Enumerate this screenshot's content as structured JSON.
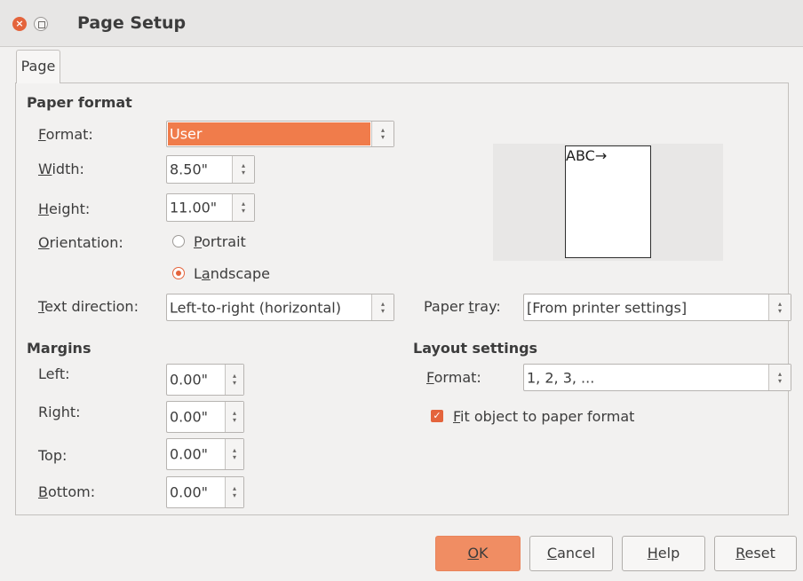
{
  "titlebar": {
    "title": "Page Setup",
    "close_glyph": "×",
    "close_icon": "close-icon",
    "maximize_icon": "maximize-icon"
  },
  "tabs": [
    {
      "label": "Page",
      "active": true
    }
  ],
  "paper_format": {
    "heading": "Paper format",
    "format": {
      "label_ul": "F",
      "label_rest": "ormat:",
      "value": "User"
    },
    "width": {
      "label_ul": "W",
      "label_rest": "idth:",
      "value": "8.50\""
    },
    "height": {
      "label_ul": "H",
      "label_rest": "eight:",
      "value": "11.00\""
    },
    "orientation": {
      "label_ul": "O",
      "label_rest": "rientation:",
      "portrait": {
        "label_ul": "P",
        "label_rest": "ortrait",
        "checked": false
      },
      "landscape": {
        "label_pre": "L",
        "label_ul": "a",
        "label_rest": "ndscape",
        "checked": true
      }
    },
    "text_direction": {
      "label_ul": "T",
      "label_rest": "ext direction:",
      "value": "Left-to-right (horizontal)"
    },
    "paper_tray": {
      "label_pre": "Paper ",
      "label_ul": "t",
      "label_rest": "ray:",
      "value": "[From printer settings]"
    },
    "preview_text": "ABC→"
  },
  "margins": {
    "heading": "Margins",
    "left": {
      "label": "Left:",
      "value": "0.00\""
    },
    "right": {
      "label": "Right:",
      "value": "0.00\""
    },
    "top": {
      "label": "Top:",
      "value": "0.00\""
    },
    "bottom": {
      "label_ul": "B",
      "label_rest": "ottom:",
      "value": "0.00\""
    }
  },
  "layout": {
    "heading": "Layout settings",
    "format": {
      "label_ul": "F",
      "label_rest": "ormat:",
      "value": "1, 2, 3, ..."
    },
    "fit": {
      "label_ul": "F",
      "label_rest": "it object to paper format",
      "checked": true,
      "check_glyph": "✓"
    }
  },
  "buttons": {
    "ok": {
      "ul": "O",
      "rest": "K"
    },
    "cancel": {
      "ul": "C",
      "rest": "ancel"
    },
    "help": {
      "ul": "H",
      "rest": "elp"
    },
    "reset": {
      "ul": "R",
      "rest": "eset"
    }
  },
  "spin_up": "▴",
  "spin_down": "▾",
  "colors": {
    "accent": "#f07c4b",
    "ok_button": "#f08d63"
  }
}
